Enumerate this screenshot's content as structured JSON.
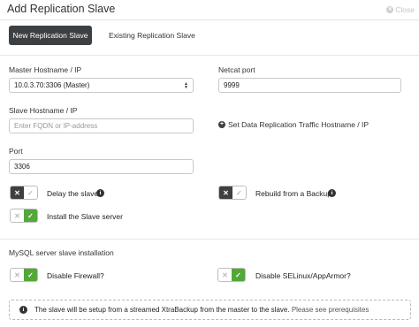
{
  "dialog": {
    "title": "Add Replication Slave",
    "close_label": "Close"
  },
  "tabs": [
    {
      "label": "New Replication Slave",
      "active": true
    },
    {
      "label": "Existing Replication Slave",
      "active": false
    }
  ],
  "form": {
    "master_host": {
      "label": "Master Hostname / IP",
      "value": "10.0.3.70:3306 (Master)"
    },
    "netcat_port": {
      "label": "Netcat port",
      "value": "9999"
    },
    "slave_host": {
      "label": "Slave Hostname / IP",
      "placeholder": "Enter FQDN or IP-address",
      "value": ""
    },
    "traffic_link": "Set Data Replication Traffic Hostname / IP",
    "port": {
      "label": "Port",
      "value": "3306"
    }
  },
  "toggles": {
    "delay_slave": {
      "label": "Delay the slave",
      "on": false
    },
    "rebuild_backup": {
      "label": "Rebuild from a Backup",
      "on": false
    },
    "install_slave": {
      "label": "Install the Slave server",
      "on": true
    },
    "disable_firewall": {
      "label": "Disable Firewall?",
      "on": true
    },
    "disable_selinux": {
      "label": "Disable SELinux/AppArmor?",
      "on": true
    }
  },
  "section_mysql": {
    "title": "MySQL server slave installation"
  },
  "info": {
    "text": "The slave will be setup from a streamed XtraBackup from the master to the slave.",
    "link": "Please see prerequisites"
  },
  "colors": {
    "toggle_on": "#52a838",
    "toggle_off": "#3c4043",
    "active_tab": "#3c4043"
  },
  "icons": {
    "close": "close-circle-icon",
    "plus": "plus-circle-icon",
    "info": "info-circle-icon",
    "check": "check-icon",
    "x": "x-icon"
  }
}
